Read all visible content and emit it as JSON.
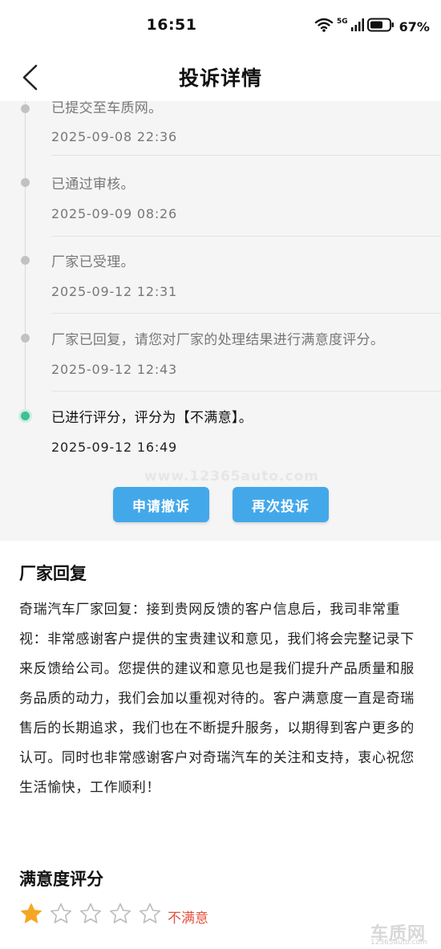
{
  "status_bar": {
    "time": "16:51",
    "net_label": "5G",
    "wifi_label": "6",
    "battery": "67%"
  },
  "nav": {
    "title": "投诉详情",
    "back_icon": "chevron-left-icon"
  },
  "timeline": [
    {
      "text": "已提交至车质网。",
      "time": "2025-09-08 22:36",
      "active": false
    },
    {
      "text": "已通过审核。",
      "time": "2025-09-09 08:26",
      "active": false
    },
    {
      "text": "厂家已受理。",
      "time": "2025-09-12 12:31",
      "active": false
    },
    {
      "text": "厂家已回复，请您对厂家的处理结果进行满意度评分。",
      "time": "2025-09-12 12:43",
      "active": false
    },
    {
      "text": "已进行评分，评分为【不满意】。",
      "time": "2025-09-12 16:49",
      "active": true
    }
  ],
  "watermark": "www.12365auto.com",
  "buttons": {
    "appeal": "申请撤诉",
    "again": "再次投诉"
  },
  "reply": {
    "title": "厂家回复",
    "body": "奇瑞汽车厂家回复：接到贵网反馈的客户信息后，我司非常重视：非常感谢客户提供的宝贵建议和意见，我们将会完整记录下来反馈给公司。您提供的建议和意见也是我们提升产品质量和服务品质的动力，我们会加以重视对待的。客户满意度一直是奇瑞售后的长期追求，我们也在不断提升服务，以期得到客户更多的认可。同时也非常感谢客户对奇瑞汽车的关注和支持，衷心祝您生活愉快，工作顺利！"
  },
  "satisfaction": {
    "title": "满意度评分",
    "rating": 1,
    "max_rating": 5,
    "label": "不满意",
    "filled_color": "#f5a623",
    "label_color": "#e2533e"
  },
  "corner": {
    "logo": "车质网",
    "url": "12365auto.com"
  },
  "colors": {
    "accent": "#43a8ea",
    "active_dot": "#3fbf95"
  }
}
